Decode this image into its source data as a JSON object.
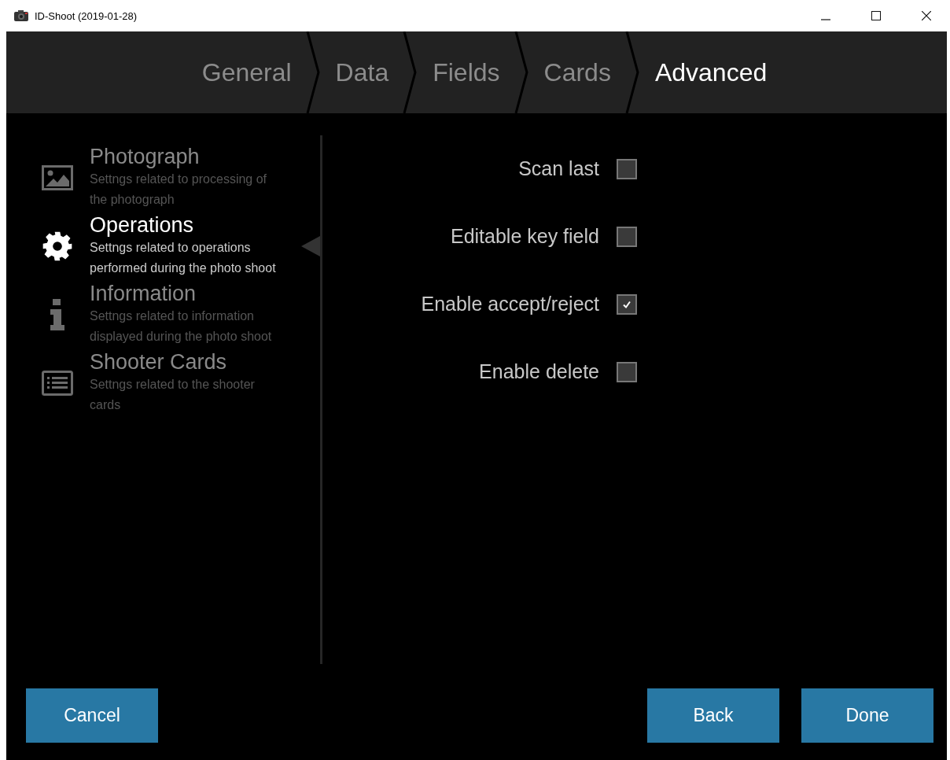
{
  "window": {
    "title": "ID-Shoot (2019-01-28)"
  },
  "tabs": [
    {
      "label": "General",
      "selected": false
    },
    {
      "label": "Data",
      "selected": false
    },
    {
      "label": "Fields",
      "selected": false
    },
    {
      "label": "Cards",
      "selected": false
    },
    {
      "label": "Advanced",
      "selected": true
    }
  ],
  "sidebar": {
    "items": [
      {
        "kind": "image",
        "title": "Photograph",
        "description": "Settngs related to processing of the photograph",
        "selected": false
      },
      {
        "kind": "gear",
        "title": "Operations",
        "description": "Settngs related to operations performed during the photo shoot",
        "selected": true
      },
      {
        "kind": "info",
        "title": "Information",
        "description": "Settngs related to information displayed during the photo shoot",
        "selected": false
      },
      {
        "kind": "list",
        "title": "Shooter Cards",
        "description": "Settngs related to the shooter cards",
        "selected": false
      }
    ]
  },
  "options": [
    {
      "label": "Scan last",
      "checked": false
    },
    {
      "label": "Editable key field",
      "checked": false
    },
    {
      "label": "Enable accept/reject",
      "checked": true
    },
    {
      "label": "Enable delete",
      "checked": false
    }
  ],
  "buttons": {
    "left": [
      "Cancel"
    ],
    "right": [
      "Back",
      "Done"
    ]
  }
}
